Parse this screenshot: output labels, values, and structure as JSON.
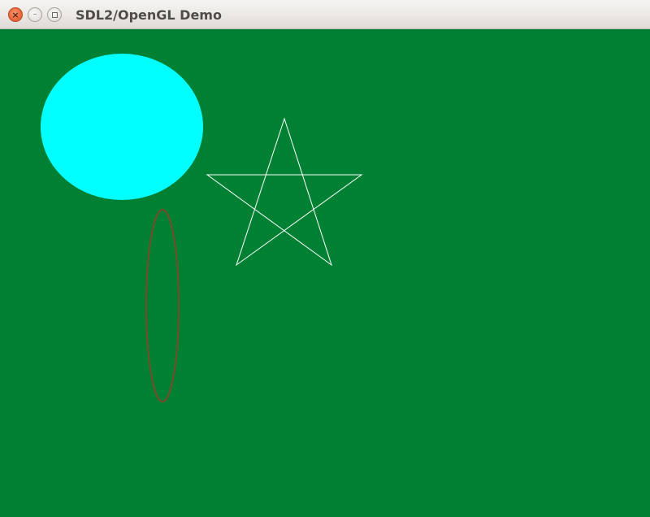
{
  "window": {
    "title": "SDL2/OpenGL Demo",
    "buttons": {
      "close_icon": "close-icon",
      "minimize_icon": "minimize-icon",
      "maximize_icon": "maximize-icon",
      "close_glyph": "×",
      "minimize_glyph": "–"
    }
  },
  "scene": {
    "background_color": "#008033",
    "shapes": [
      {
        "kind": "filled-ellipse",
        "fill": "#00ffff"
      },
      {
        "kind": "outlined-ellipse",
        "stroke": "#7a4a2a"
      },
      {
        "kind": "outlined-star",
        "stroke": "#ffffff"
      }
    ]
  }
}
